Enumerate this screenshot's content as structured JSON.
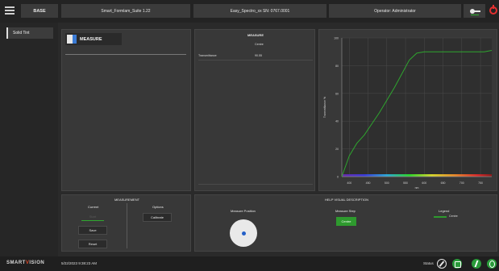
{
  "topbar": {
    "base_label": "BASE",
    "suite_label": "Smart_Formlam_Suite 1.22",
    "serial_label": "Easy_Spectro_xx SN: 0767.0001",
    "operator_label": "Operator: Administrator",
    "key_icon": "key-icon",
    "power_icon": "power-icon"
  },
  "sidebar": {
    "items": [
      {
        "label": "Solid Tint"
      }
    ]
  },
  "measure_panel": {
    "button_label": "MEASURE",
    "icon": "measure-icon"
  },
  "results_table": {
    "title": "MEASURE",
    "column_header": "Centre",
    "row_label": "Transmittance",
    "row_value": "90.55"
  },
  "chart_data": {
    "type": "line",
    "title": "",
    "xlabel": "nm",
    "ylabel": "Transmittance %",
    "xlim": [
      380,
      780
    ],
    "ylim": [
      0,
      100
    ],
    "x_ticks": [
      400,
      450,
      500,
      550,
      600,
      650,
      700,
      750
    ],
    "y_ticks": [
      0,
      20,
      40,
      60,
      80,
      100
    ],
    "grid": true,
    "series": [
      {
        "name": "Centre",
        "color": "#2fa52f",
        "x": [
          380,
          400,
          420,
          440,
          460,
          480,
          500,
          520,
          540,
          560,
          580,
          600,
          620,
          640,
          660,
          680,
          700,
          720,
          740,
          760,
          780
        ],
        "y": [
          0,
          15,
          24,
          30,
          38,
          46,
          55,
          64,
          74,
          84,
          89,
          90,
          90,
          90,
          90,
          90,
          90,
          90,
          90,
          90,
          91
        ]
      }
    ]
  },
  "measurement": {
    "title": "MEASUREMENT",
    "current_label": "Current",
    "options_label": "Options",
    "start_label": "Start",
    "save_label": "Save",
    "reset_label": "Reset",
    "calibrate_label": "Calibrate"
  },
  "help": {
    "title": "HELP VISUAL DESCRIPTION",
    "position_label": "Measure Position",
    "step_label": "Measure Step",
    "legend_label": "Legend",
    "step_button": "Centre",
    "legend_item": "Centre"
  },
  "footer": {
    "brand_prefix": "SMART",
    "brand_v": "V",
    "brand_suffix": "ISION",
    "datetime": "5/22/2023   9:38:23 AM",
    "status_label": "Status"
  }
}
